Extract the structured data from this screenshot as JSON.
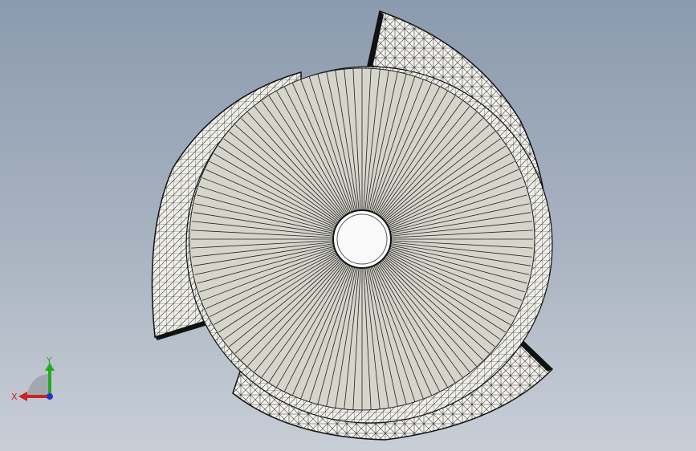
{
  "viewport": {
    "background_top": "#8b9aae",
    "background_bottom": "#c8ced6"
  },
  "model": {
    "face_color": "#d6d5cc",
    "edge_color": "#111111",
    "mesh_color": "#ffffff",
    "shading": "shaded-with-edges"
  },
  "triad": {
    "x_label": "X",
    "y_label": "Y",
    "x_color": "#cc2222",
    "y_color": "#22aa22",
    "z_color": "#2233cc"
  }
}
